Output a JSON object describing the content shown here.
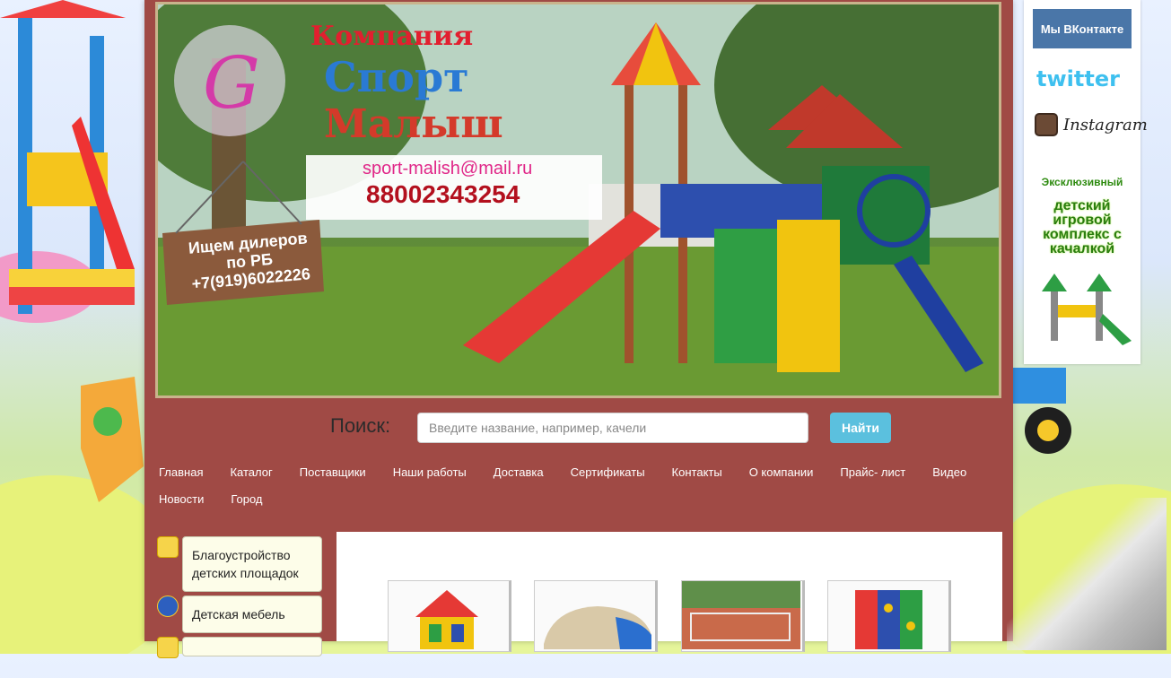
{
  "banner": {
    "company_line1": "Компания",
    "company_line2": "Спорт",
    "company_line3": "Малыш",
    "email": "sport-malish@mail.ru",
    "phone": "88002343254",
    "dealer_line1": "Ищем дилеров",
    "dealer_line2": "по РБ",
    "dealer_phone": "+7(919)6022226"
  },
  "search": {
    "label": "Поиск:",
    "placeholder": "Введите название, например, качели",
    "button": "Найти"
  },
  "nav": [
    "Главная",
    "Каталог",
    "Поставщики",
    "Наши работы",
    "Доставка",
    "Сертификаты",
    "Контакты",
    "О компании",
    "Прайс- лист",
    "Видео",
    "Новости",
    "Город"
  ],
  "sidebar": {
    "categories": [
      "Благоустройство детских площадок",
      "Детская мебель"
    ]
  },
  "social": {
    "vk": "Мы ВКонтакте",
    "twitter": "twitter",
    "instagram": "Instagram",
    "ad_small": "Эксклюзивный",
    "ad_big": "детский игровой комплекс с качалкой"
  },
  "colors": {
    "page_bg": "#a04a45",
    "search_button": "#5bc0de",
    "vk": "#4a76a8"
  }
}
